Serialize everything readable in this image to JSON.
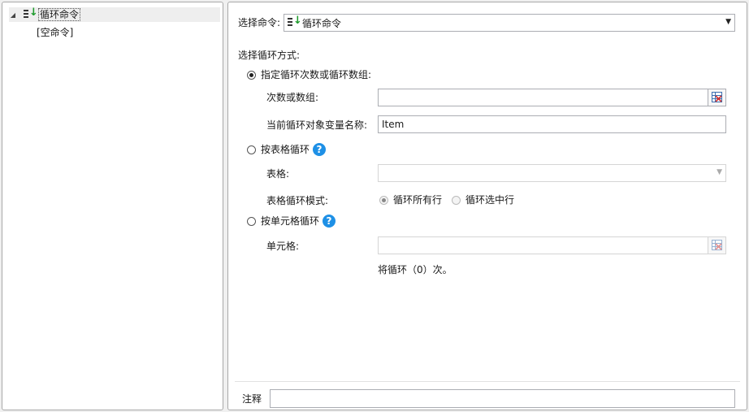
{
  "tree": {
    "root_label": "循环命令",
    "empty_label": "[空命令]"
  },
  "command": {
    "label": "选择命令:",
    "selected": "循环命令"
  },
  "loop_mode": {
    "section_label": "选择循环方式:",
    "by_count": {
      "label": "指定循环次数或循环数组:",
      "selected": true,
      "count_label": "次数或数组:",
      "count_value": "",
      "var_label": "当前循环对象变量名称:",
      "var_value": "Item"
    },
    "by_table": {
      "label": "按表格循环",
      "selected": false,
      "table_label": "表格:",
      "table_value": "",
      "mode_label": "表格循环模式:",
      "mode_all": "循环所有行",
      "mode_selected": "循环选中行"
    },
    "by_cell": {
      "label": "按单元格循环",
      "selected": false,
      "cell_label": "单元格:",
      "cell_value": ""
    },
    "summary": "将循环（0）次。"
  },
  "notes": {
    "label": "注释",
    "value": ""
  },
  "icons": {
    "loop": "loop-command-icon",
    "help": "help-icon",
    "grid": "cell-picker-icon"
  },
  "colors": {
    "help_blue": "#1e90e6",
    "loop_arrow_green": "#1c9a2a",
    "picker_red": "#d03030"
  }
}
